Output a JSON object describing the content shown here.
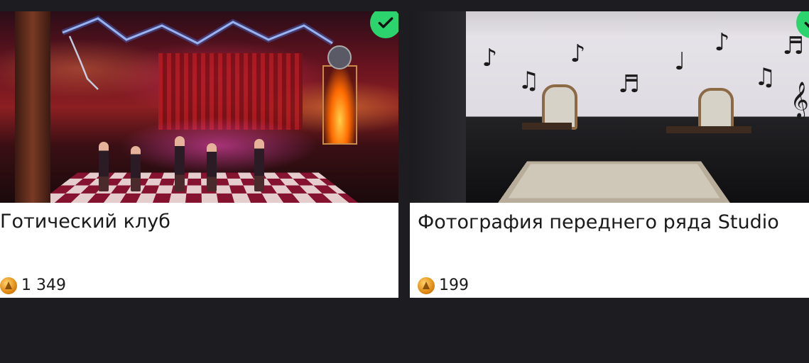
{
  "items": [
    {
      "title": "Готический клуб",
      "price": "1 349",
      "purchased": true,
      "image_icon": "gothic-club-image",
      "currency_icon": "coin-icon",
      "badge_icon": "checkmark-icon",
      "badge_color": "#2bd46d"
    },
    {
      "title": "Фотография переднего ряда Studio",
      "price": "199",
      "purchased": true,
      "image_icon": "music-studio-image",
      "currency_icon": "coin-icon",
      "badge_icon": "checkmark-icon",
      "badge_color": "#2bd46d"
    }
  ],
  "colors": {
    "background": "#1d1c21",
    "card": "#ffffff",
    "coin": "#e28a12"
  }
}
